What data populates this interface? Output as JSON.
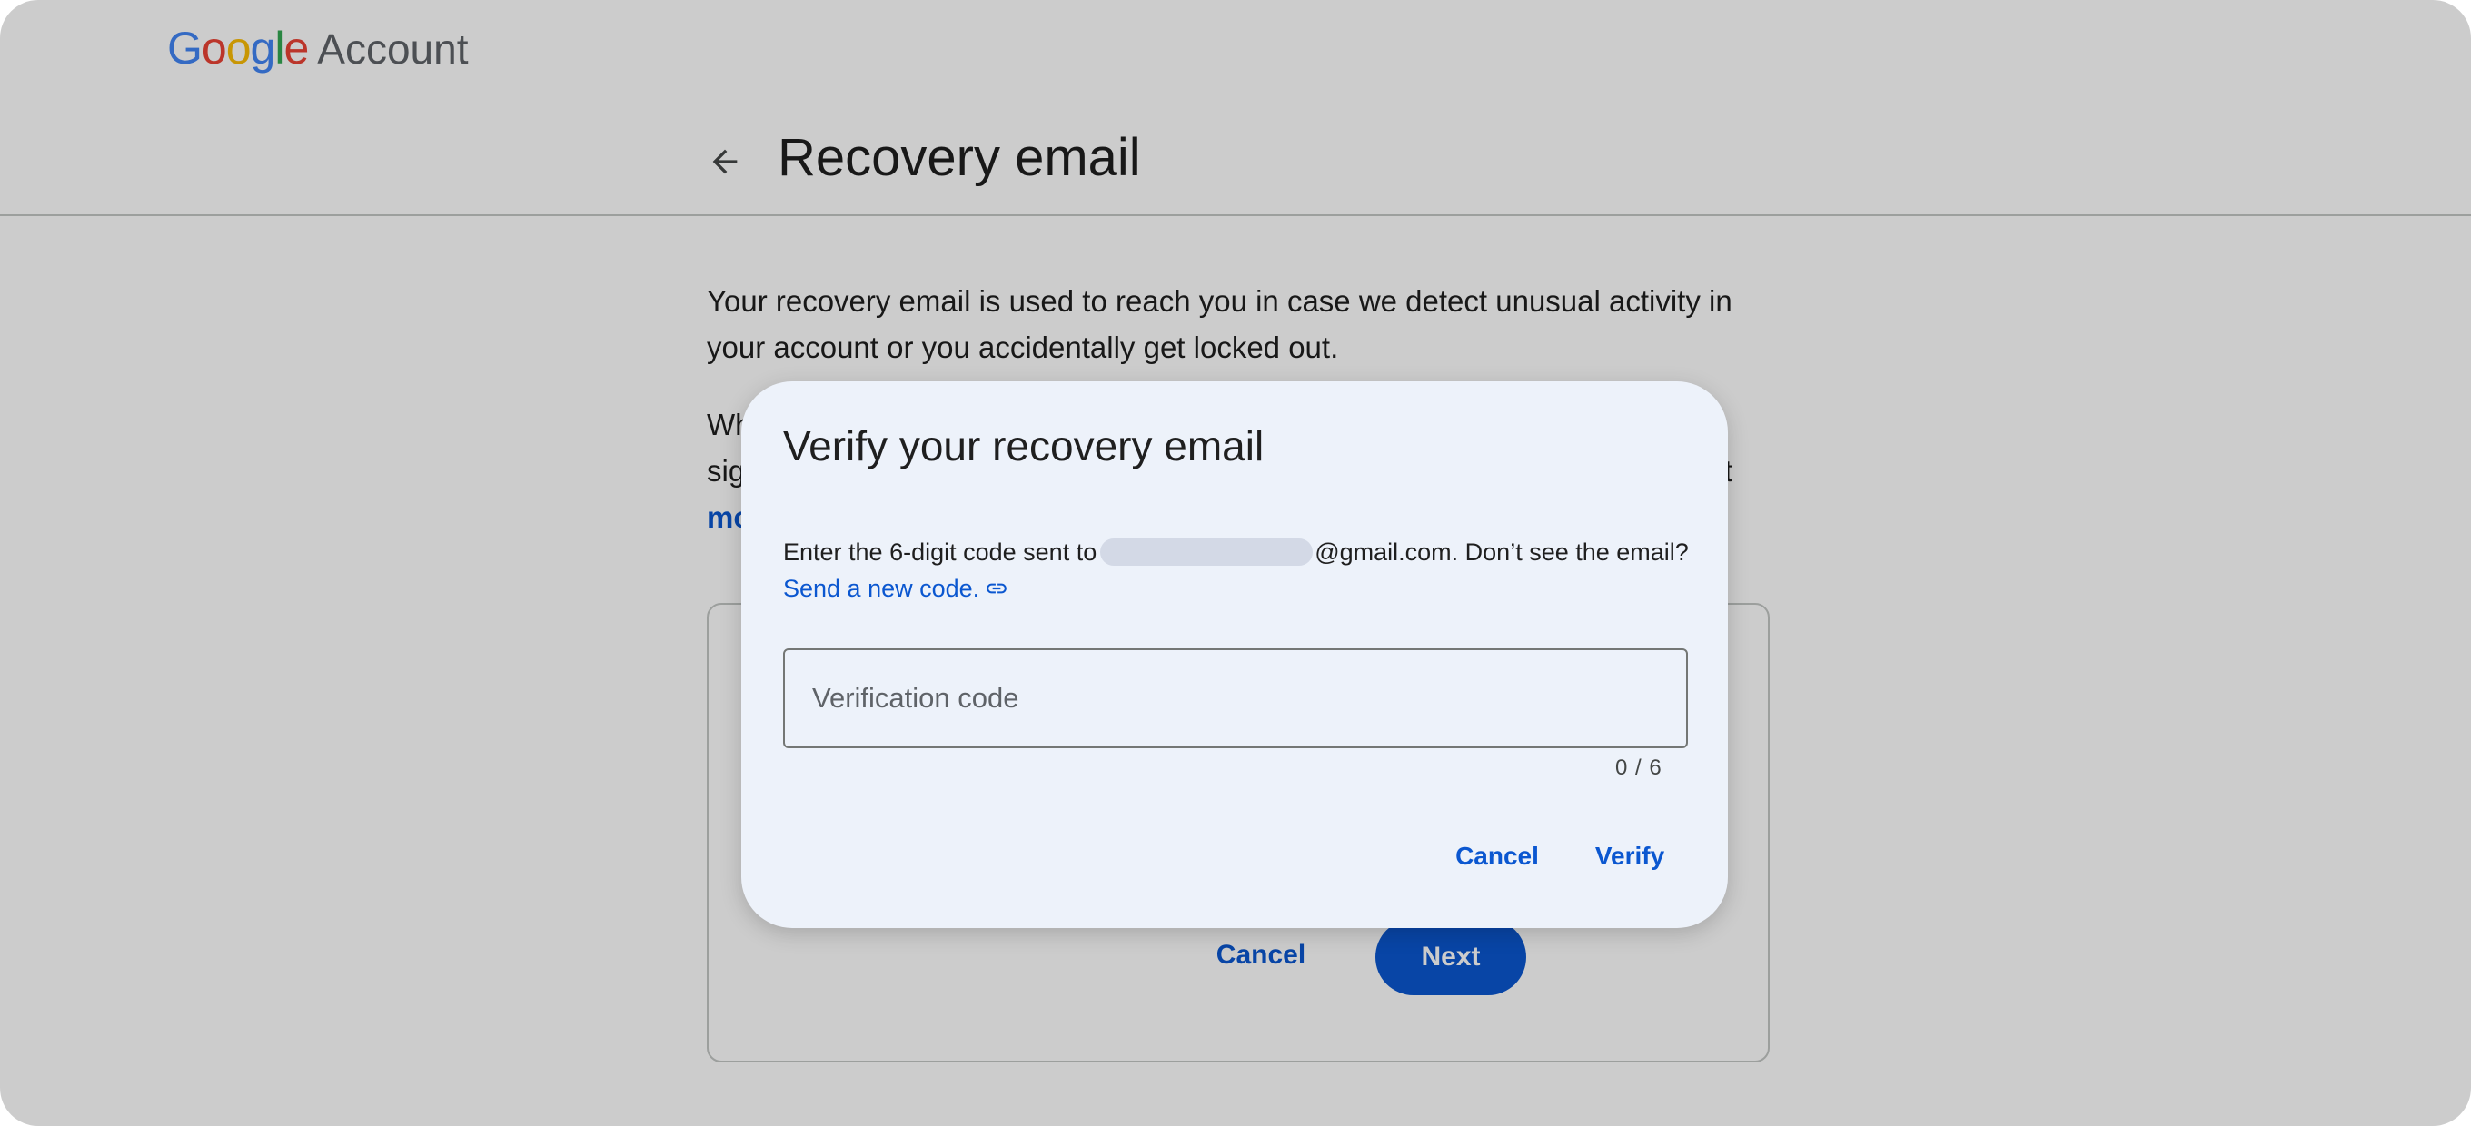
{
  "brand": {
    "logo_letters": [
      {
        "ch": "G",
        "color": "#4285F4"
      },
      {
        "ch": "o",
        "color": "#EA4335"
      },
      {
        "ch": "o",
        "color": "#FBBC05"
      },
      {
        "ch": "g",
        "color": "#4285F4"
      },
      {
        "ch": "l",
        "color": "#34A853"
      },
      {
        "ch": "e",
        "color": "#EA4335"
      }
    ],
    "product": "Account"
  },
  "header": {
    "back_icon": "arrow-back-icon",
    "title": "Recovery email"
  },
  "page": {
    "description": "Your recovery email is used to reach you in case we detect unusual activity in your account or you accidentally get locked out.",
    "partial_line_1": "Wh",
    "partial_line_2": "sig",
    "partial_line_2_tail": "t",
    "partial_link": "mo",
    "card": {
      "cancel_label": "Cancel",
      "next_label": "Next"
    }
  },
  "dialog": {
    "title": "Verify your recovery email",
    "message_before": "Enter the 6-digit code sent to",
    "message_after": "@gmail.com. Don’t see the email?",
    "link_label": "Send a new code.",
    "link_icon": "link-icon",
    "input_placeholder": "Verification code",
    "input_value": "",
    "counter": "0 / 6",
    "cancel_label": "Cancel",
    "verify_label": "Verify"
  },
  "colors": {
    "accent": "#0b57d0",
    "dialog_bg": "#edf2fa",
    "scrim": "rgba(0,0,0,0.20)"
  }
}
